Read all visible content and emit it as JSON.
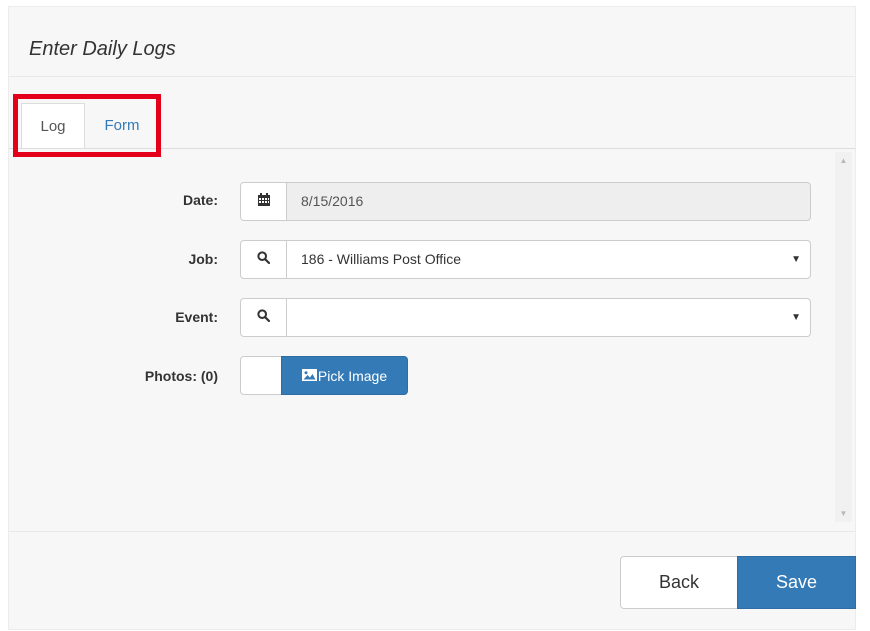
{
  "modal": {
    "title": "Enter Daily Logs"
  },
  "tabs": [
    {
      "label": "Log",
      "active": true
    },
    {
      "label": "Form",
      "active": false
    }
  ],
  "form": {
    "date": {
      "label": "Date:",
      "value": "8/15/2016",
      "icon": "calendar-icon"
    },
    "job": {
      "label": "Job:",
      "value": "186 - Williams Post Office",
      "icon": "search-icon"
    },
    "event": {
      "label": "Event:",
      "value": "",
      "icon": "search-icon"
    },
    "photos": {
      "label": "Photos: (0)",
      "button_label": "Pick Image",
      "icon": "image-icon"
    }
  },
  "footer": {
    "back_label": "Back",
    "save_label": "Save"
  },
  "colors": {
    "primary": "#337ab7",
    "highlight": "#e4001b",
    "tab_link": "#337ab7"
  }
}
